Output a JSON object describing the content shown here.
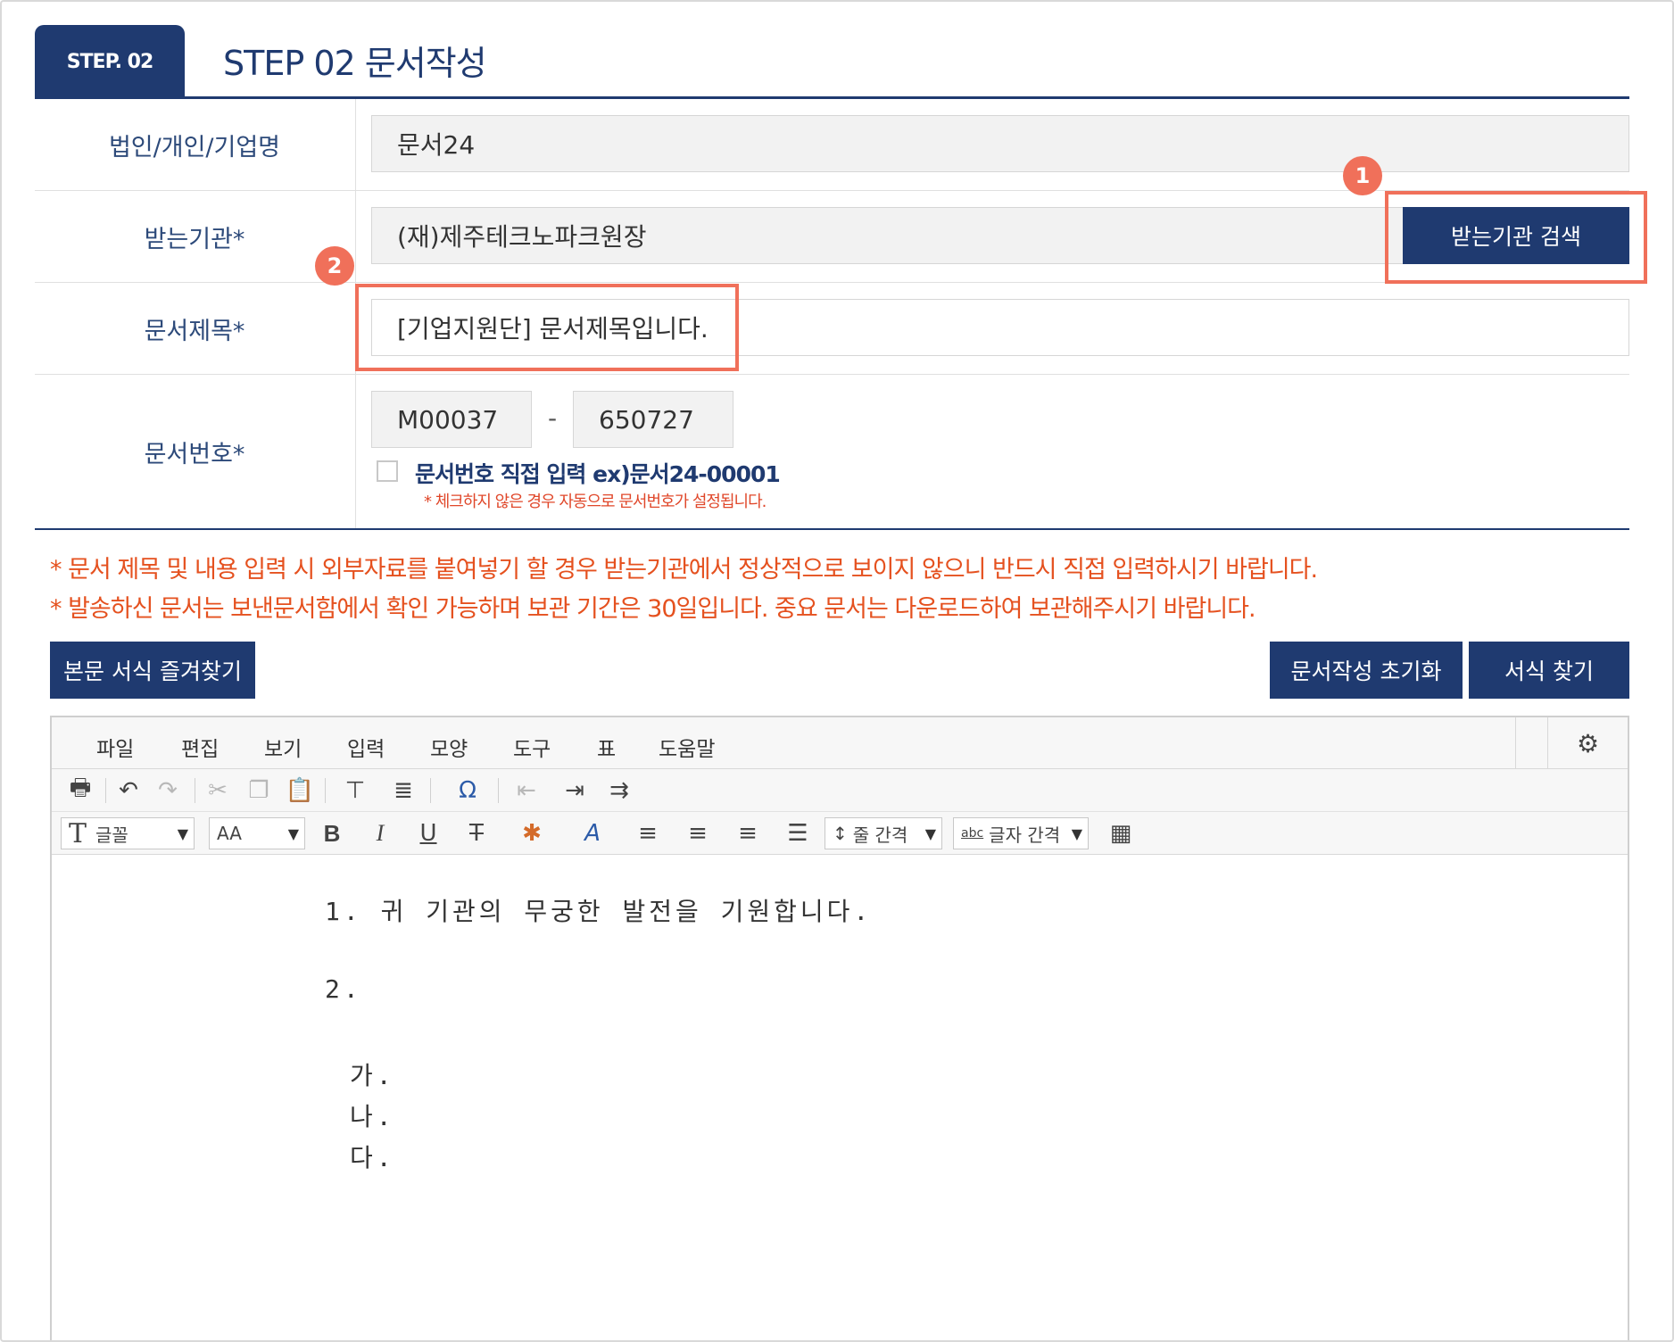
{
  "header": {
    "step_tab": "STEP. 02",
    "title": "STEP 02 문서작성"
  },
  "form": {
    "company_label": "법인/개인/기업명",
    "company_value": "문서24",
    "recipient_label": "받는기관*",
    "recipient_value": "(재)제주테크노파크원장",
    "recipient_search_button": "받는기관 검색",
    "doc_title_label": "문서제목*",
    "doc_title_value": "[기업지원단] 문서제목입니다.",
    "doc_number_label": "문서번호*",
    "doc_number_prefix": "M00037",
    "doc_number_dash": "-",
    "doc_number_suffix": "650727",
    "manual_number_label": "문서번호 직접 입력 ex)문서24-00001",
    "manual_number_note": "* 체크하지 않은 경우 자동으로 문서번호가 설정됩니다."
  },
  "annotations": {
    "badge1": "1",
    "badge2": "2"
  },
  "notices": [
    "* 문서 제목 및 내용 입력 시 외부자료를 붙여넣기 할 경우 받는기관에서 정상적으로 보이지 않으니 반드시 직접 입력하시기 바랍니다.",
    "* 발송하신 문서는 보낸문서함에서 확인 가능하며 보관 기간은 30일입니다. 중요 문서는 다운로드하여 보관해주시기 바랍니다."
  ],
  "buttons": {
    "favorites": "본문 서식 즐겨찾기",
    "reset": "문서작성 초기화",
    "find_form": "서식 찾기"
  },
  "editor": {
    "menu": [
      "파일",
      "편집",
      "보기",
      "입력",
      "모양",
      "도구",
      "표",
      "도움말"
    ],
    "font_select": "글꼴",
    "size_select": "AA",
    "line_spacing": "줄 간격",
    "letter_spacing": "글자 간격",
    "letter_spacing_icon_text": "abc",
    "icons": {
      "print": "print-icon",
      "undo": "undo-icon",
      "redo": "redo-icon",
      "cut": "cut-icon",
      "copy": "copy-icon",
      "paste": "paste-icon",
      "gear": "gear-icon"
    },
    "content": {
      "line1": "1. 귀 기관의 무궁한 발전을 기원합니다.",
      "line2": "2.",
      "item_a": "가.",
      "item_b": "나.",
      "item_c": "다."
    }
  },
  "colors": {
    "navy": "#1f3a70",
    "highlight": "#f0705a",
    "notice": "#e5511f"
  }
}
